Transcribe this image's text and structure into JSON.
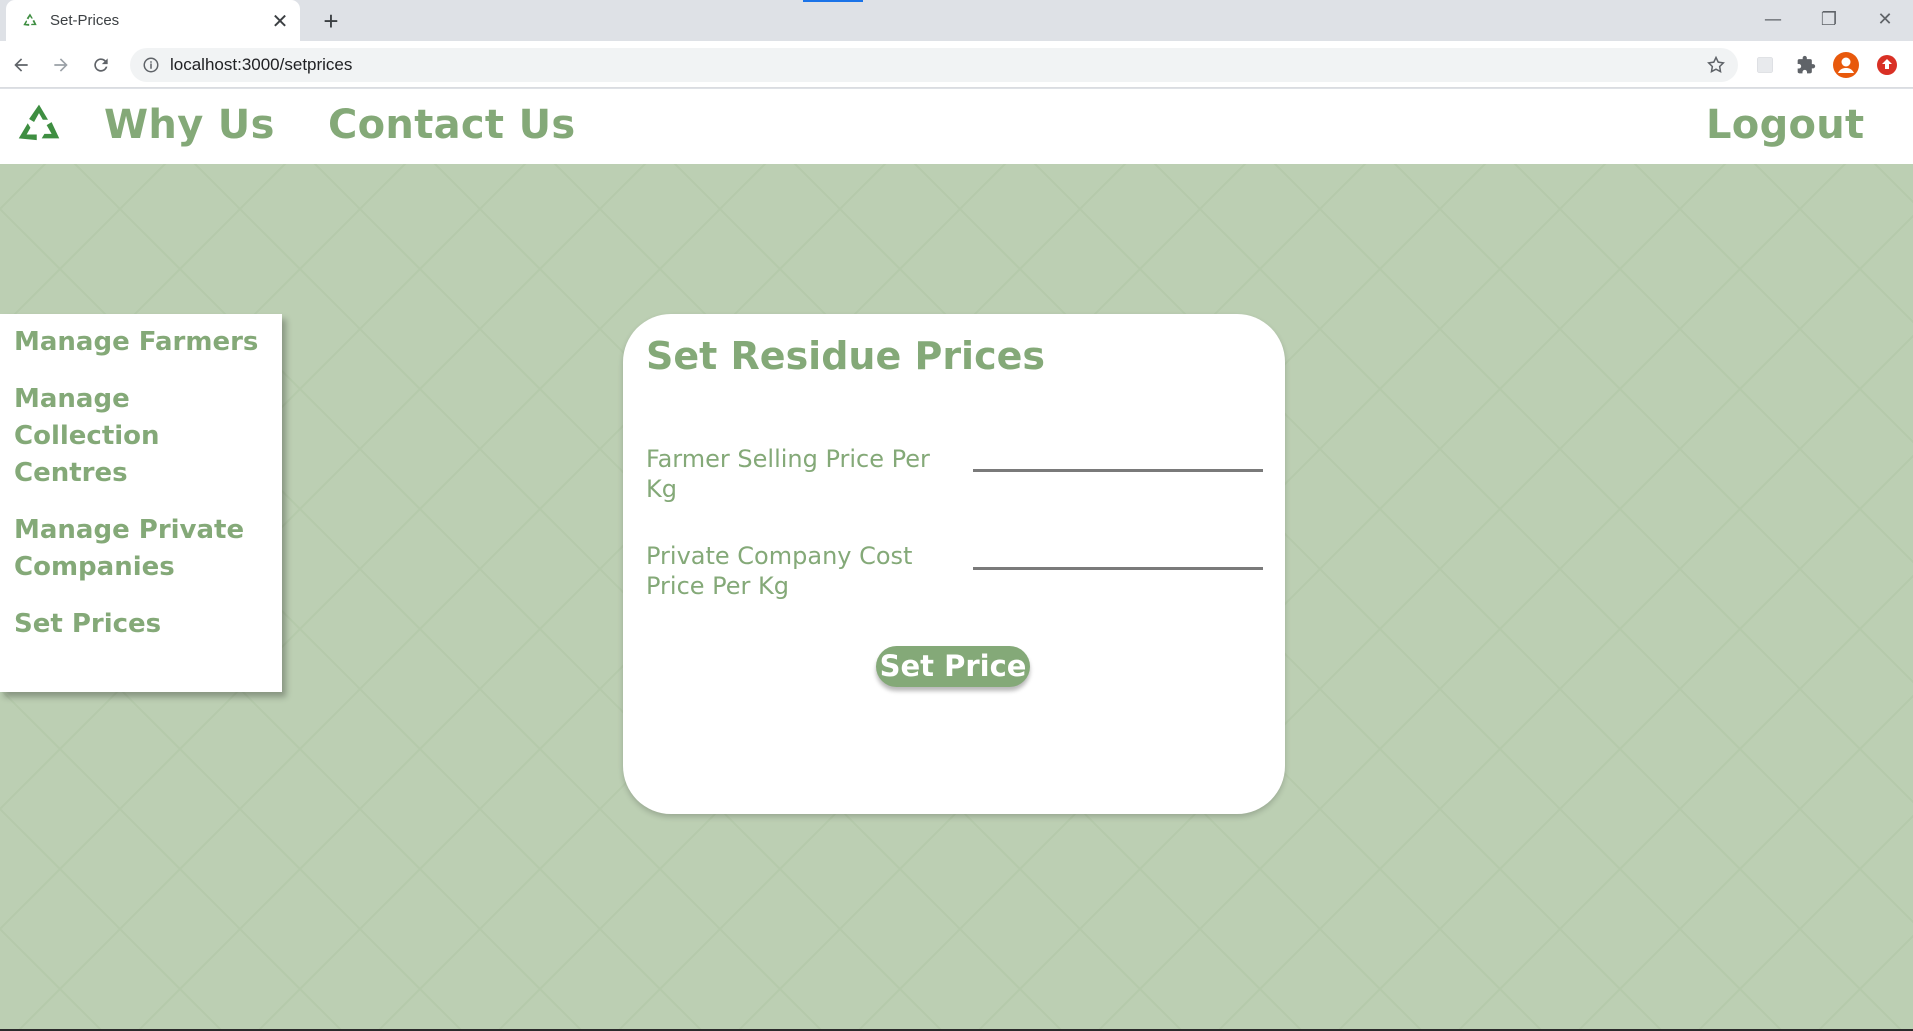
{
  "browser": {
    "tab_title": "Set-Prices",
    "tab_close": "✕",
    "new_tab": "+",
    "url": "localhost:3000/setprices",
    "window_controls": [
      "—",
      "❐",
      "✕"
    ]
  },
  "header": {
    "nav": [
      {
        "label": "Why Us"
      },
      {
        "label": "Contact Us"
      }
    ],
    "logout_label": "Logout"
  },
  "sidebar": {
    "items": [
      {
        "label": "Manage Farmers"
      },
      {
        "label": "Manage Collection Centres"
      },
      {
        "label": "Manage Private Companies"
      },
      {
        "label": "Set Prices"
      }
    ]
  },
  "form": {
    "title": "Set Residue Prices",
    "fields": [
      {
        "label": "Farmer Selling Price Per Kg",
        "value": "",
        "placeholder": ""
      },
      {
        "label": "Private Company Cost Price Per Kg",
        "value": "",
        "placeholder": ""
      }
    ],
    "submit_label": "Set Price"
  },
  "colors": {
    "brand_green": "#84a978",
    "page_bg": "#bccfb3"
  },
  "icons": [
    "recycle-icon",
    "back-arrow-icon",
    "forward-arrow-icon",
    "reload-icon",
    "info-icon",
    "star-icon",
    "extensions-icon",
    "profile-icon",
    "update-icon"
  ]
}
